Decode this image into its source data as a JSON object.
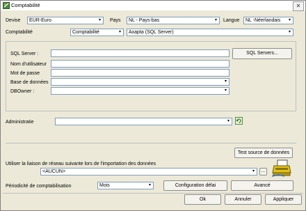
{
  "window": {
    "title": "Comptabilité",
    "close_glyph": "✕"
  },
  "header": {
    "devise_label": "Devise",
    "devise_value": "EUR-Euro",
    "pays_label": "Pays",
    "pays_value": "NL - Pays-bas",
    "langue_label": "Langue",
    "langue_value": "NL -Néerlandais",
    "comptabilite_label": "Comptabilité",
    "comptabilite_value": "Comptabilité",
    "system_value": "Axapta (SQL Server)"
  },
  "connection": {
    "sql_server_label": "SQL Server :",
    "sql_server_value": "",
    "sql_servers_button": "SQL Servers...",
    "user_label": "Nom d'utilisateur",
    "user_value": "",
    "password_label": "Mot de passe",
    "password_value": "",
    "database_label": "Base de données",
    "database_value": "",
    "dbowner_label": "DBOwner :",
    "dbowner_value": ""
  },
  "admin": {
    "label": "Administratie",
    "value": ""
  },
  "test_button": "Test source de données",
  "network": {
    "label": "Utiliser la liaison de réseau suivante lors de l'importation des données",
    "value": "<AUCUN>",
    "browse_label": "..."
  },
  "periodicity": {
    "label": "Périodicité de comptabilisation",
    "value": "Mois",
    "config_button": "Configuration délai",
    "advanced_button": "Avancé"
  },
  "footer": {
    "ok": "Ok",
    "cancel": "Annuler",
    "apply": "Appliquer"
  },
  "dropdown_glyph": "▾"
}
